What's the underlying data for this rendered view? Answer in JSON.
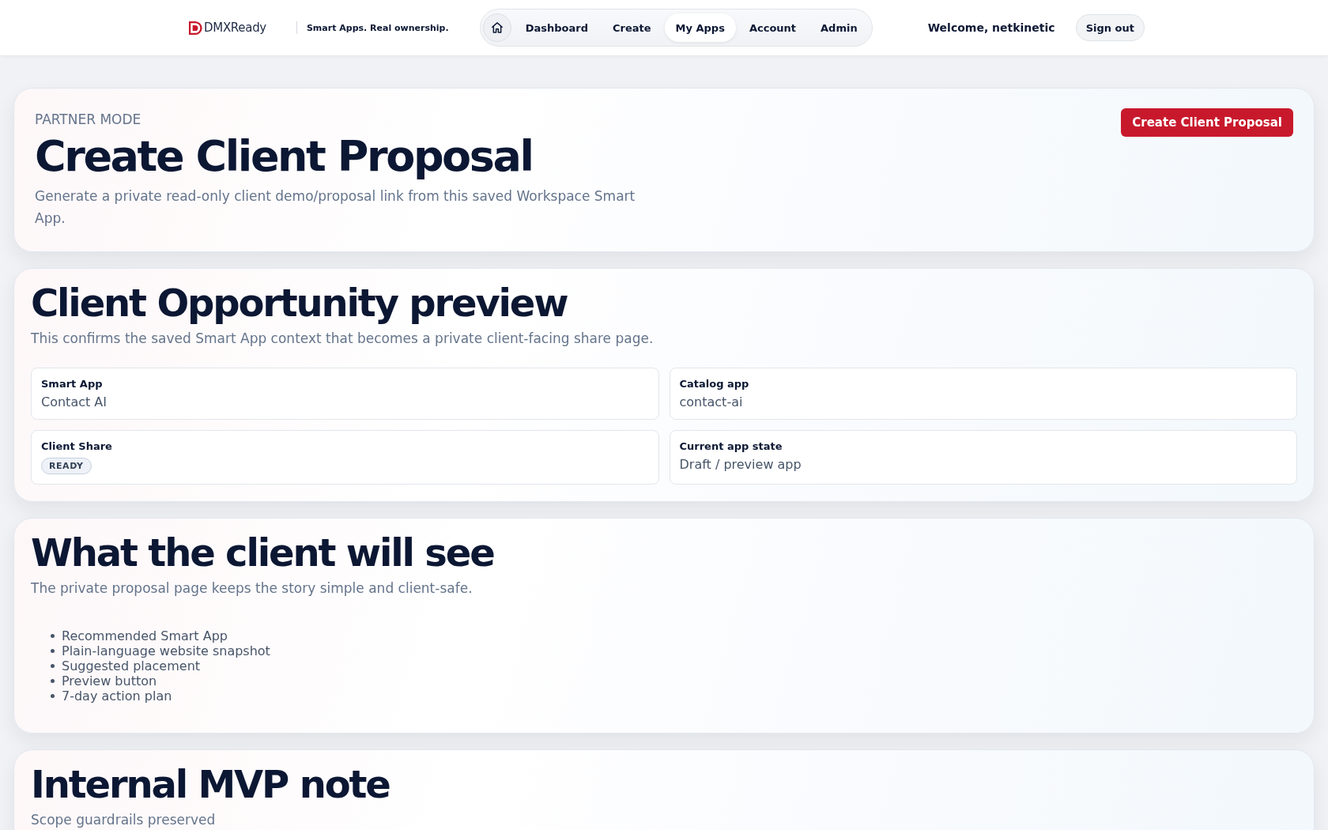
{
  "header": {
    "brand": "DMXReady",
    "tagline": "Smart Apps. Real ownership.",
    "nav": [
      {
        "kind": "home",
        "selected": false
      },
      {
        "kind": "link",
        "label": "Dashboard",
        "selected": false
      },
      {
        "kind": "link",
        "label": "Create",
        "selected": false
      },
      {
        "kind": "link",
        "label": "My Apps",
        "selected": true
      },
      {
        "kind": "link",
        "label": "Account",
        "selected": false
      },
      {
        "kind": "link",
        "label": "Admin",
        "selected": false
      }
    ],
    "welcome": "Welcome, netkinetic",
    "sign_out": "Sign out"
  },
  "hero": {
    "eyebrow": "PARTNER MODE",
    "title": "Create Client Proposal",
    "subtitle": "Generate a private read-only client demo/proposal link from this saved Workspace Smart App.",
    "action": "Create Client Proposal"
  },
  "sections": [
    {
      "title": "Client Opportunity preview",
      "subtitle": "This confirms the saved Smart App context that becomes a private client-facing share page.",
      "fields": [
        {
          "kind": "text",
          "label": "Smart App",
          "value": "Contact AI"
        },
        {
          "kind": "text",
          "label": "Catalog app",
          "value": "contact-ai"
        },
        {
          "kind": "badge",
          "label": "Client Share",
          "value": "READY"
        },
        {
          "kind": "text",
          "label": "Current app state",
          "value": "Draft / preview app"
        }
      ]
    },
    {
      "title": "What the client will see",
      "subtitle": "The private proposal page keeps the story simple and client-safe.",
      "items": [
        "Recommended Smart App",
        "Plain-language website snapshot",
        "Suggested placement",
        "Preview button",
        "7-day action plan"
      ]
    },
    {
      "title": "Internal MVP note",
      "subtitle": "Scope guardrails preserved"
    }
  ]
}
